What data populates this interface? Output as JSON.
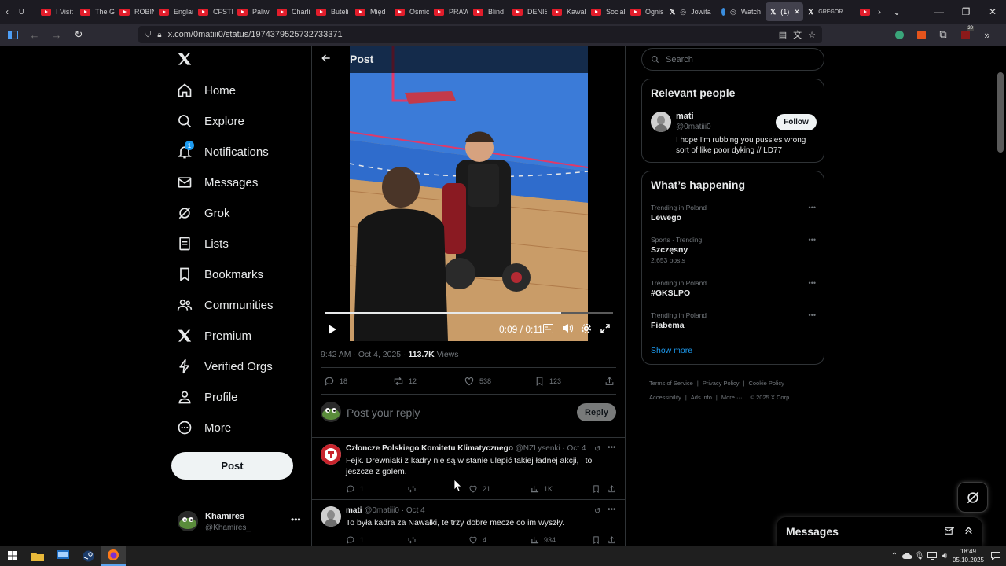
{
  "browser": {
    "tabs": [
      {
        "label": "U"
      },
      {
        "label": "I Visit"
      },
      {
        "label": "The G"
      },
      {
        "label": "ROBIN"
      },
      {
        "label": "Englar"
      },
      {
        "label": "CFSTI"
      },
      {
        "label": "Paliwi"
      },
      {
        "label": "Charli"
      },
      {
        "label": "Buteli"
      },
      {
        "label": "Międ"
      },
      {
        "label": "Ośmic"
      },
      {
        "label": "PRAW"
      },
      {
        "label": "Blind"
      },
      {
        "label": "DENIS"
      },
      {
        "label": "Kawal"
      },
      {
        "label": "Social"
      },
      {
        "label": "Ognis"
      },
      {
        "label": "Jowita"
      },
      {
        "label": "Watch"
      },
      {
        "label": "(1)"
      },
      {
        "label": "GREGOR"
      }
    ],
    "url": "x.com/0matiii0/status/1974379525732733371",
    "extension_badge": "20"
  },
  "nav": {
    "home": "Home",
    "explore": "Explore",
    "notifications": "Notifications",
    "notifications_badge": "1",
    "messages": "Messages",
    "grok": "Grok",
    "lists": "Lists",
    "bookmarks": "Bookmarks",
    "communities": "Communities",
    "premium": "Premium",
    "verified_orgs": "Verified Orgs",
    "profile": "Profile",
    "more": "More",
    "post_button": "Post"
  },
  "account": {
    "name": "Khamires",
    "handle": "@Khamires_"
  },
  "post": {
    "header": "Post",
    "video_time": "0:09 / 0:11",
    "video_progress": 0.82,
    "timestamp": "9:42 AM · Oct 4, 2025 · ",
    "views_count": "113.7K",
    "views_label": " Views",
    "replies": "18",
    "reposts": "12",
    "likes": "538",
    "bookmarks": "123",
    "reply_placeholder": "Post your reply",
    "reply_button": "Reply"
  },
  "replies": [
    {
      "name": "Członcze Polskiego Komitetu Klimatycznego",
      "handle": "@NZLysenki · Oct 4",
      "text": "Fejk. Drewniaki z kadry nie są w stanie ulepić takiej ładnej akcji, i to jeszcze z golem.",
      "replies": "1",
      "likes": "21",
      "views": "1K"
    },
    {
      "name": "mati",
      "handle": "@0matiii0 · Oct 4",
      "text": "To była kadra za Nawałki, te trzy dobre mecze co im wyszły.",
      "replies": "1",
      "likes": "4",
      "views": "934"
    }
  ],
  "search": {
    "placeholder": "Search"
  },
  "relevant": {
    "title": "Relevant people",
    "name": "mati",
    "handle": "@0matiii0",
    "follow": "Follow",
    "bio": "I hope I'm rubbing you pussies wrong sort of like poor dyking // LD77"
  },
  "happening": {
    "title": "What’s happening",
    "trends": [
      {
        "context": "Trending in Poland",
        "name": "Lewego",
        "posts": ""
      },
      {
        "context": "Sports · Trending",
        "name": "Szczęsny",
        "posts": "2,653 posts"
      },
      {
        "context": "Trending in Poland",
        "name": "#GKSLPO",
        "posts": ""
      },
      {
        "context": "Trending in Poland",
        "name": "Fiabema",
        "posts": ""
      }
    ],
    "show_more": "Show more"
  },
  "footer": {
    "terms": "Terms of Service",
    "privacy": "Privacy Policy",
    "cookie": "Cookie Policy",
    "accessibility": "Accessibility",
    "ads": "Ads info",
    "more": "More ···",
    "copyright": "© 2025 X Corp."
  },
  "messages_drawer": {
    "title": "Messages"
  },
  "taskbar": {
    "time": "18:49",
    "date": "05.10.2025"
  },
  "colors": {
    "accent": "#1d9bf0",
    "background": "#000000",
    "border": "#2f3336",
    "muted": "#71767b"
  }
}
